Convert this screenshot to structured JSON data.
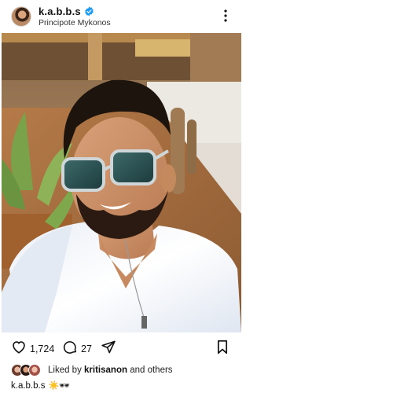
{
  "header": {
    "username": "k.a.b.b.s",
    "location": "Principote Mykonos",
    "avatar_icon": "profile-avatar",
    "verified_icon": "verified-badge-icon",
    "more_icon": "vertical-ellipsis-icon"
  },
  "post": {
    "image_alt_icon": "selfie-photo"
  },
  "actions": {
    "like_icon": "heart-icon",
    "like_count": "1,724",
    "comment_icon": "comment-bubble-icon",
    "comment_count": "27",
    "share_icon": "paper-plane-icon",
    "save_icon": "bookmark-icon"
  },
  "likes": {
    "prefix": "Liked by ",
    "user": "kritisanon",
    "suffix": " and others"
  },
  "caption": {
    "username": "k.a.b.b.s",
    "text": "☀️🕶"
  },
  "colors": {
    "verified_blue": "#1d9bf0",
    "text": "#111111",
    "background": "#ffffff"
  }
}
